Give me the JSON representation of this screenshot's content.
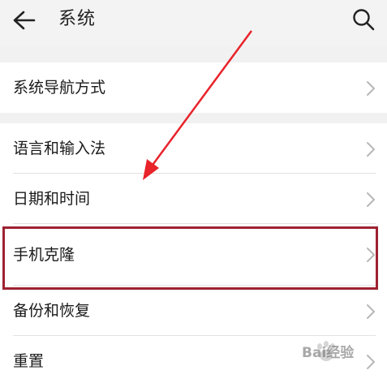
{
  "header": {
    "title": "系统",
    "back_icon": "back-arrow-icon",
    "search_icon": "search-icon"
  },
  "groups": [
    {
      "items": [
        {
          "label": "系统导航方式"
        }
      ]
    },
    {
      "items": [
        {
          "label": "语言和输入法"
        },
        {
          "label": "日期和时间"
        },
        {
          "label": "手机克隆",
          "highlighted": true
        },
        {
          "label": "备份和恢复"
        },
        {
          "label": "重置"
        }
      ]
    }
  ],
  "annotation": {
    "highlight_color": "#9e2233",
    "arrow_color": "#e8232a"
  },
  "watermark": {
    "text": "Bai经验"
  }
}
